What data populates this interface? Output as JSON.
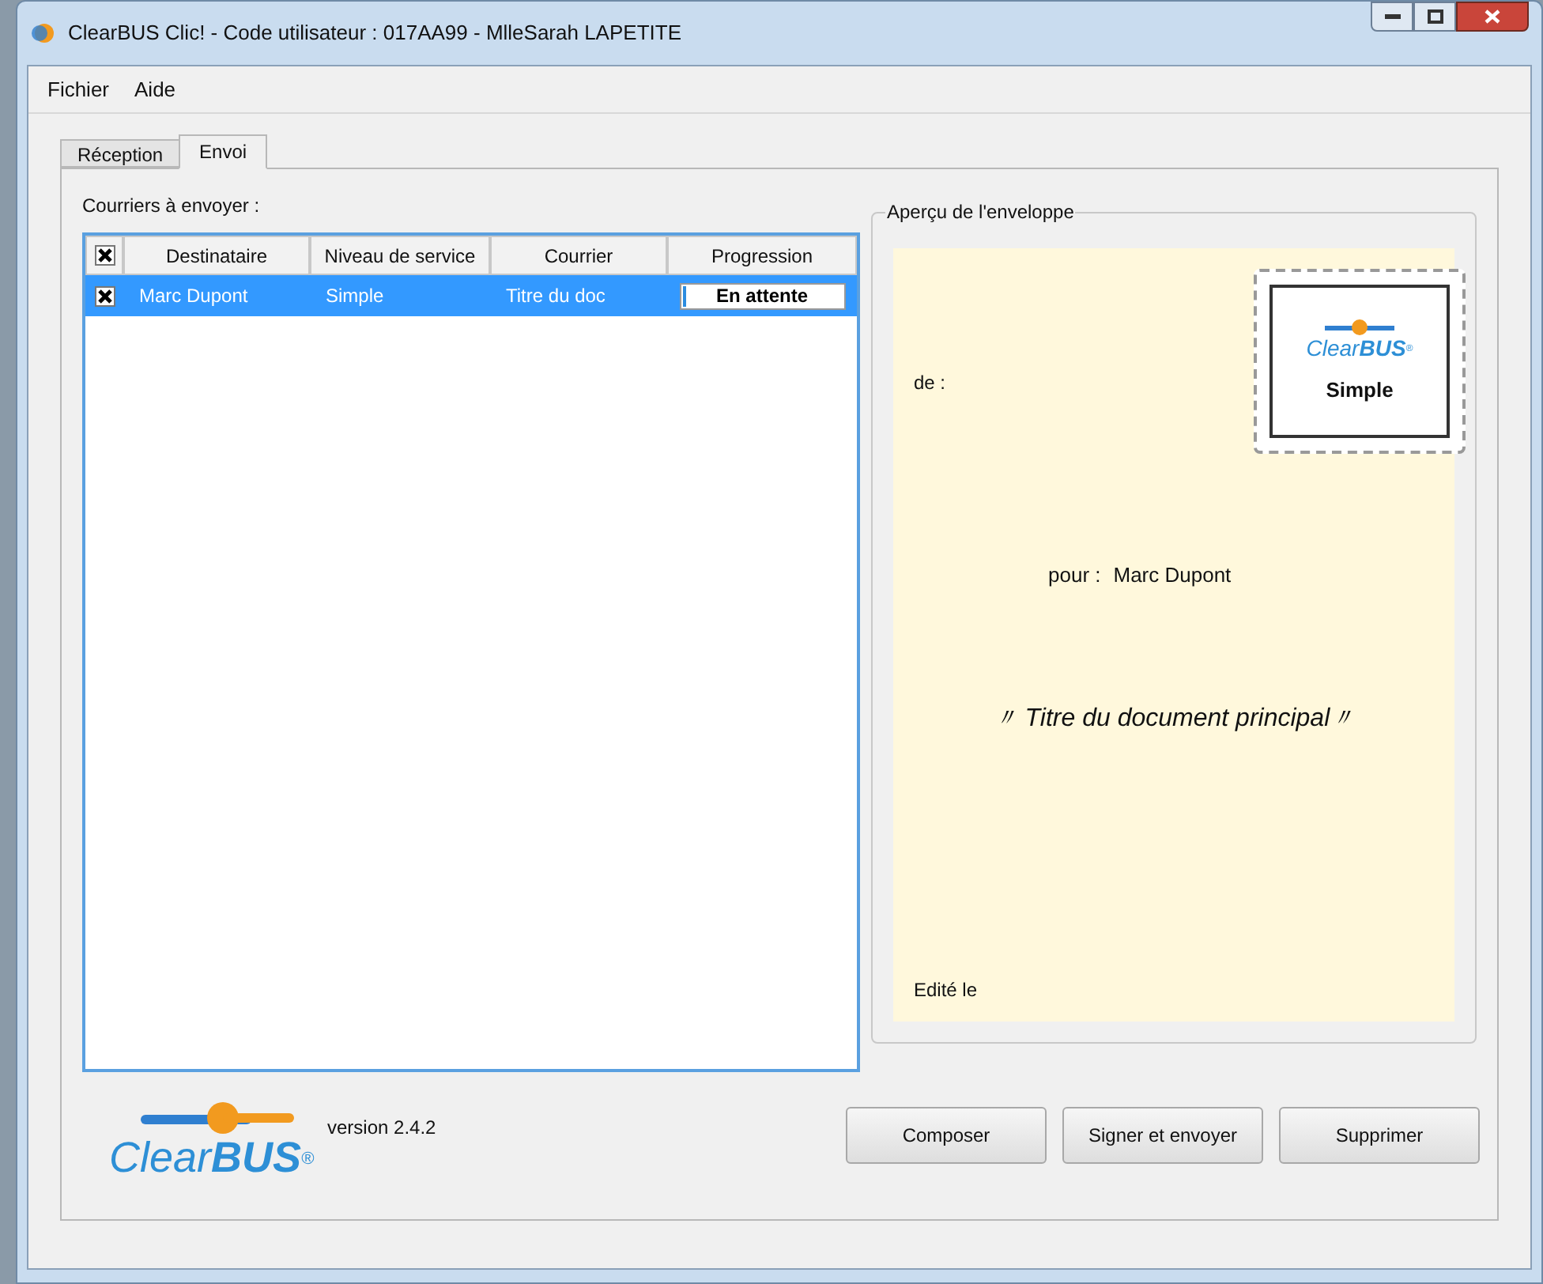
{
  "window": {
    "title": "ClearBUS Clic! - Code utilisateur : 017AA99 - MlleSarah LAPETITE"
  },
  "menu": [
    "Fichier",
    "Aide"
  ],
  "tabs": [
    {
      "label": "Réception",
      "selected": false
    },
    {
      "label": "Envoi",
      "selected": true
    }
  ],
  "list": {
    "label": "Courriers à envoyer :",
    "columns": [
      "Destinataire",
      "Niveau de service",
      "Courrier",
      "Progression"
    ],
    "header_checked": true,
    "rows": [
      {
        "checked": true,
        "selected": true,
        "cells": [
          "Marc Dupont",
          "Simple",
          "Titre du doc"
        ],
        "progress": {
          "label": "En attente",
          "level": 0.02
        }
      }
    ]
  },
  "envelope": {
    "title": "Aperçu de l'enveloppe",
    "from_label": "de :",
    "stamp": {
      "logo_a": "Clear",
      "logo_b": "BUS",
      "mark": "®",
      "service": "Simple"
    },
    "to_label": "pour :",
    "to_name": "Marc Dupont",
    "document_title": "〃 Titre du document principal〃",
    "edited_label": "Edité le"
  },
  "logo": {
    "text_a": "Clear",
    "text_b": "BUS",
    "mark": "®"
  },
  "version": "version 2.4.2",
  "buttons": [
    "Composer",
    "Signer et envoyer",
    "Supprimer"
  ]
}
